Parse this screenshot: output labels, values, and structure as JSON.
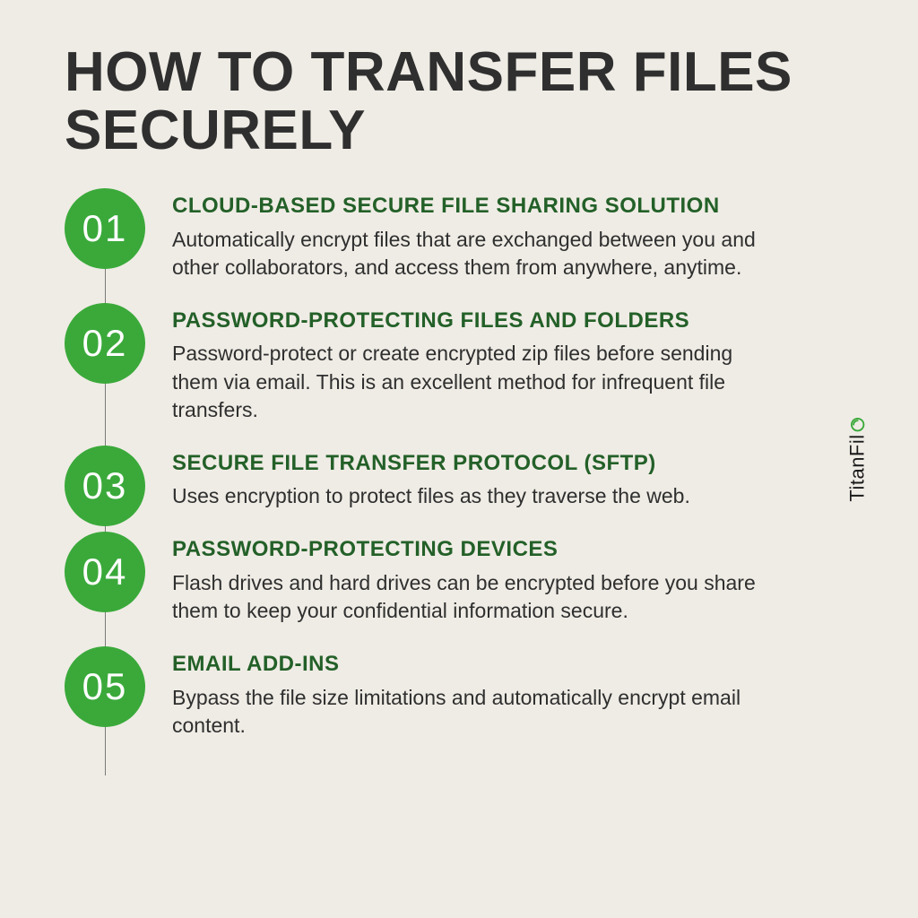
{
  "title": "HOW TO TRANSFER FILES SECURELY",
  "brand": {
    "name_part1": "TitanFil",
    "name_part2": "e",
    "logo_aria": "TitanFile logo"
  },
  "steps": [
    {
      "num": "01",
      "title": "CLOUD-BASED SECURE FILE SHARING SOLUTION",
      "body": "Automatically encrypt files that are exchanged between you and other collaborators, and access them from anywhere, anytime."
    },
    {
      "num": "02",
      "title": "PASSWORD-PROTECTING FILES AND FOLDERS",
      "body": "Password-protect or create encrypted zip files before sending them via email. This is an excellent method for infrequent file transfers."
    },
    {
      "num": "03",
      "title": "SECURE FILE TRANSFER PROTOCOL (SFTP)",
      "body": "Uses encryption to protect files as they traverse the web."
    },
    {
      "num": "04",
      "title": "PASSWORD-PROTECTING DEVICES",
      "body": "Flash drives and hard drives can be encrypted before you share them to keep your confidential information secure."
    },
    {
      "num": "05",
      "title": "EMAIL ADD-INS",
      "body": "Bypass the file size limitations and automatically encrypt email content."
    }
  ]
}
